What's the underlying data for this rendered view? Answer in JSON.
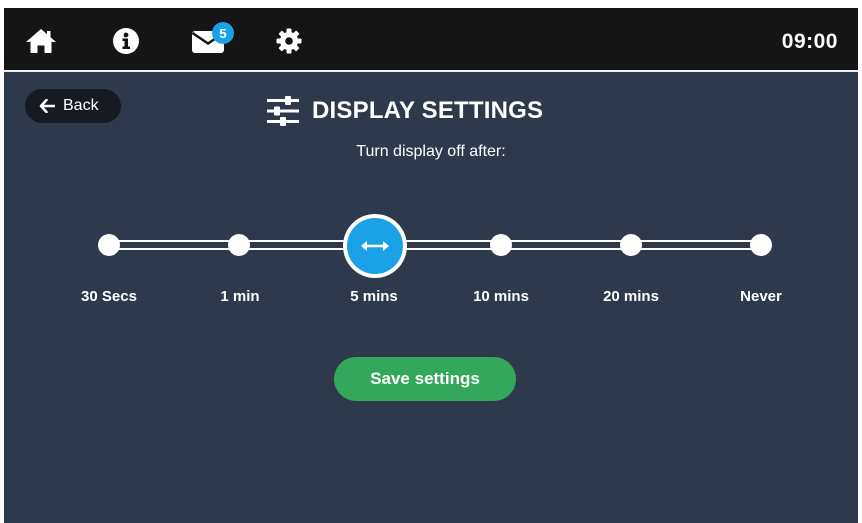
{
  "topbar": {
    "icons": {
      "home": "home-icon",
      "info": "info-icon",
      "mail": "envelope-icon",
      "settings": "gear-icon"
    },
    "mail_badge_count": "5",
    "clock": "09:00"
  },
  "header": {
    "back_label": "Back",
    "title_icon": "sliders-icon",
    "title": "DISPLAY SETTINGS",
    "subtitle": "Turn display off after:"
  },
  "slider": {
    "stops": [
      "30 Secs",
      "1 min",
      "5 mins",
      "10 mins",
      "20 mins",
      "Never"
    ],
    "selected_index": 2,
    "selected_value": "5 mins",
    "handle_icon": "horizontal-arrows-icon"
  },
  "save_label": "Save settings",
  "colors": {
    "background": "#2e3a4b",
    "topbar": "#151515",
    "accent": "#1ba2e6",
    "save": "#34a85a",
    "back_button": "#161b22"
  }
}
